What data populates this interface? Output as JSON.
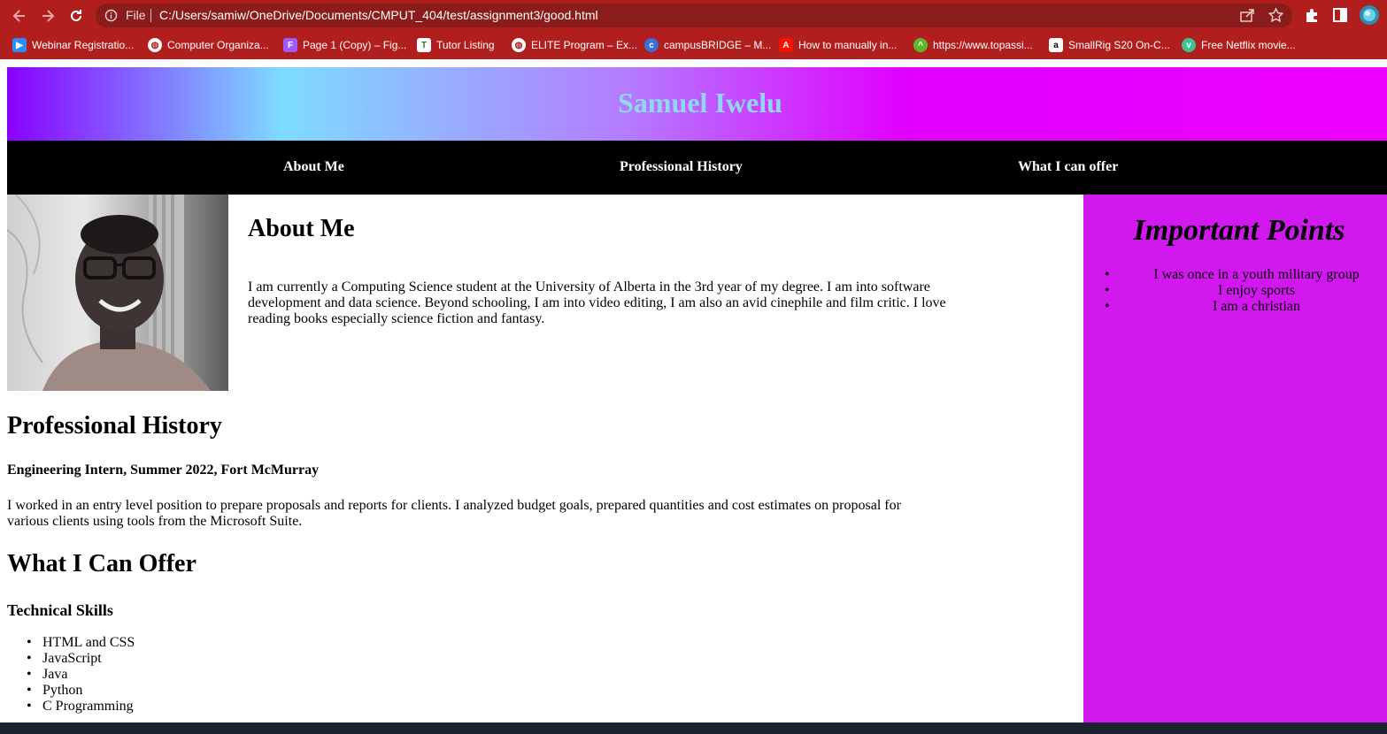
{
  "browser": {
    "omnibox": {
      "scheme_label": "File",
      "url": "C:/Users/samiw/OneDrive/Documents/CMPUT_404/test/assignment3/good.html"
    },
    "icons": [
      "back-arrow-icon",
      "forward-arrow-icon",
      "reload-icon",
      "info-icon",
      "share-icon",
      "star-icon",
      "extensions-puzzle-icon",
      "side-panel-icon",
      "profile-avatar-icon"
    ],
    "theme_color": "#b11e1e"
  },
  "bookmarks": [
    {
      "label": "Webinar Registratio...",
      "icon": "zoom-icon",
      "color": "#2d8cff"
    },
    {
      "label": "Computer Organiza...",
      "icon": "globe-icon",
      "color": "#ffffff"
    },
    {
      "label": "Page 1 (Copy) – Fig...",
      "icon": "figma-icon",
      "color": "#a259ff"
    },
    {
      "label": "Tutor Listing",
      "icon": "tutor-icon",
      "color": "#ffffff"
    },
    {
      "label": "ELITE Program – Ex...",
      "icon": "globe-icon",
      "color": "#ffffff"
    },
    {
      "label": "campusBRIDGE – M...",
      "icon": "campusbridge-icon",
      "color": "#3a6fd8"
    },
    {
      "label": "How to manually in...",
      "icon": "adobe-icon",
      "color": "#fa0f00"
    },
    {
      "label": "https://www.topassi...",
      "icon": "topassist-icon",
      "color": "#5cb82a"
    },
    {
      "label": "SmallRig S20 On-C...",
      "icon": "amazon-icon",
      "color": "#ffffff"
    },
    {
      "label": "Free Netflix movie...",
      "icon": "netflix-v-icon",
      "color": "#3ec28f"
    }
  ],
  "site": {
    "title": "Samuel Iwelu",
    "nav": [
      "About Me",
      "Professional History",
      "What I can offer"
    ],
    "about": {
      "heading": "About Me",
      "text": "I am currently a Computing Science student at the University of Alberta in the 3rd year of my degree. I am into software development and data science. Beyond schooling, I am into video editing, I am also an avid cinephile and film critic. I love reading books especially science fiction and fantasy."
    },
    "sidebar": {
      "heading": "Important Points",
      "items": [
        "I was once in a youth military group",
        "I enjoy sports",
        "I am a christian"
      ],
      "color": "#d118ee"
    },
    "professional": {
      "heading": "Professional History",
      "subheading": "Engineering Intern, Summer 2022, Fort McMurray",
      "text": "I worked in an entry level position to prepare proposals and reports for clients. I analyzed budget goals, prepared quantities and cost estimates on proposal for various clients using tools from the Microsoft Suite."
    },
    "offer": {
      "heading": "What I Can Offer",
      "subheading": "Technical Skills",
      "skills": [
        "HTML and CSS",
        "JavaScript",
        "Java",
        "Python",
        "C Programming"
      ]
    }
  }
}
